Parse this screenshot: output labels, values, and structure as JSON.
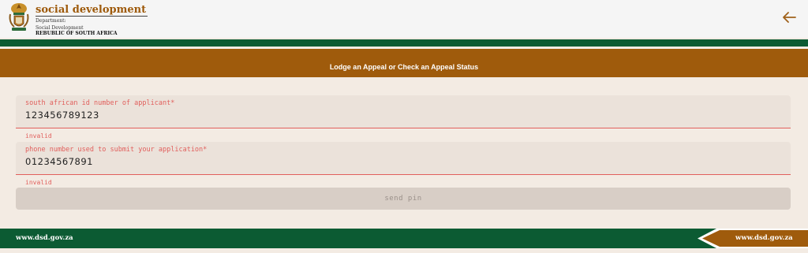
{
  "header": {
    "title": "social development",
    "dept_line1": "Department:",
    "dept_line2": "Social Development",
    "country": "REBUBLIC OF SOUTH AFRICA",
    "back_icon": "arrow-left-icon",
    "logo_icon": "coat-of-arms-icon"
  },
  "banner": {
    "title": "Lodge an Appeal or Check an Appeal Status"
  },
  "form": {
    "id_field": {
      "label": "south african id number of applicant*",
      "value": "123456789123",
      "error": "invalid"
    },
    "phone_field": {
      "label": "phone number used to submit your application*",
      "value": "01234567891",
      "error": "invalid"
    },
    "submit_label": "send pin"
  },
  "footer": {
    "link_left": "www.dsd.gov.za",
    "link_right": "www.dsd.gov.za"
  },
  "colors": {
    "brand_brown": "#9f5b0c",
    "brand_green": "#0c5b33",
    "error_red": "#e15f5c",
    "page_bg": "#f3ebe3"
  }
}
